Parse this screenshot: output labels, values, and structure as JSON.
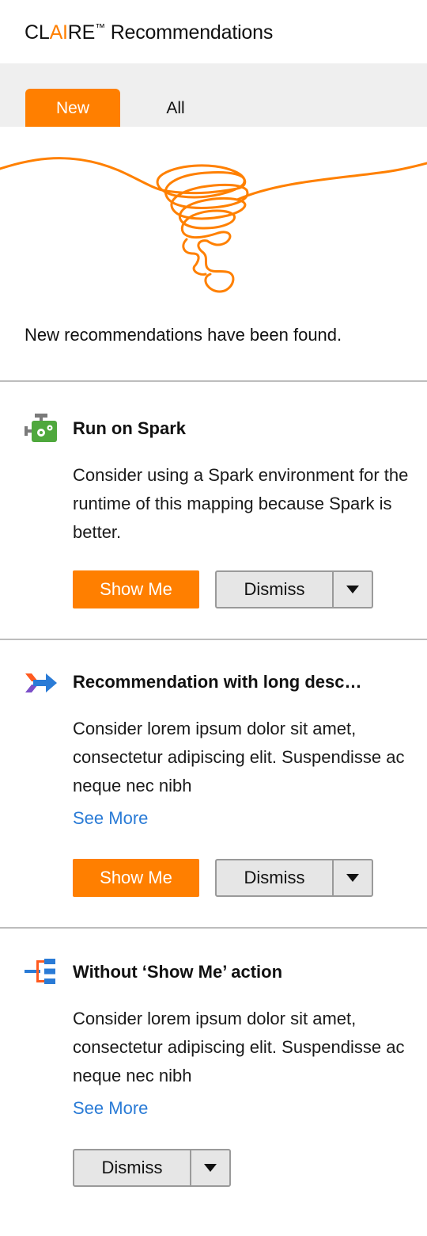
{
  "header": {
    "title_prefix": "CL",
    "title_ai": "AI",
    "title_suffix": "RE",
    "trademark": "™",
    "title_rest": " Recommendations"
  },
  "tabs": [
    {
      "label": "New",
      "active": true
    },
    {
      "label": "All",
      "active": false
    }
  ],
  "banner": {
    "message": "New recommendations have been found."
  },
  "recommendations": [
    {
      "icon": "spark-engine-icon",
      "title": "Run on Spark",
      "description": "Consider using a Spark environment for the runtime of this mapping because Spark is better.",
      "see_more": "",
      "show_me": "Show Me",
      "dismiss": "Dismiss"
    },
    {
      "icon": "merge-arrow-icon",
      "title": "Recommendation with long desc…",
      "description": "Consider lorem ipsum dolor sit amet, consectetur adipiscing elit. Suspendisse ac neque nec nibh",
      "see_more": "See More",
      "show_me": "Show Me",
      "dismiss": "Dismiss"
    },
    {
      "icon": "hierarchy-icon",
      "title": "Without ‘Show Me’ action",
      "description": "Consider lorem ipsum dolor sit amet, consectetur adipiscing elit. Suspendisse ac neque nec nibh",
      "see_more": "See More",
      "dismiss": "Dismiss"
    }
  ],
  "colors": {
    "accent": "#ff7f00",
    "link": "#2a7bd6",
    "divider": "#bdbdbd",
    "tabbar": "#efefef"
  }
}
